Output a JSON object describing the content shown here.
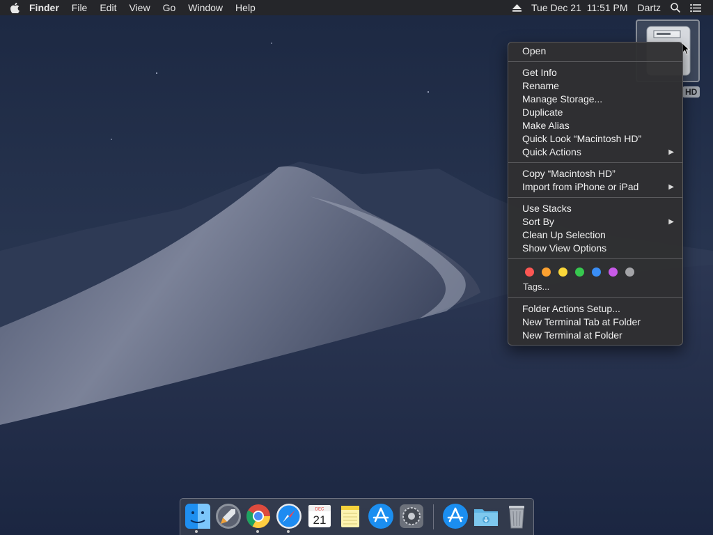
{
  "menubar": {
    "app_name": "Finder",
    "menus": [
      "File",
      "Edit",
      "View",
      "Go",
      "Window",
      "Help"
    ],
    "datetime": "Tue Dec 21  11:51 PM",
    "user": "Dartz",
    "icons": {
      "apple": "apple-icon",
      "eject": "eject-icon",
      "search": "spotlight-search-icon",
      "list": "notification-center-icon"
    }
  },
  "desktop": {
    "disk_label": "HD",
    "disk_icon": "hard-disk-icon"
  },
  "context_menu": {
    "group1": [
      "Open"
    ],
    "group2": [
      "Get Info",
      "Rename",
      "Manage Storage...",
      "Duplicate",
      "Make Alias",
      "Quick Look “Macintosh HD”",
      "Quick Actions"
    ],
    "group3": [
      "Copy “Macintosh HD”",
      "Import from iPhone or iPad"
    ],
    "group4": [
      "Use Stacks",
      "Sort By",
      "Clean Up Selection",
      "Show View Options"
    ],
    "tag_colors": [
      "#fc5753",
      "#fca130",
      "#fbd83a",
      "#37c84f",
      "#3a8ef6",
      "#c85ae8",
      "#a4a4a8"
    ],
    "tags_label": "Tags...",
    "group5": [
      "Folder Actions Setup...",
      "New Terminal Tab at Folder",
      "New Terminal at Folder"
    ]
  },
  "dock": {
    "apps": [
      "Finder",
      "Launchpad",
      "Google Chrome",
      "Safari",
      "Calendar",
      "Notes",
      "App Store",
      "System Preferences",
      "App Store Downloads",
      "Downloads Folder",
      "Trash"
    ],
    "calendar_month": "DEC",
    "calendar_day": "21"
  }
}
